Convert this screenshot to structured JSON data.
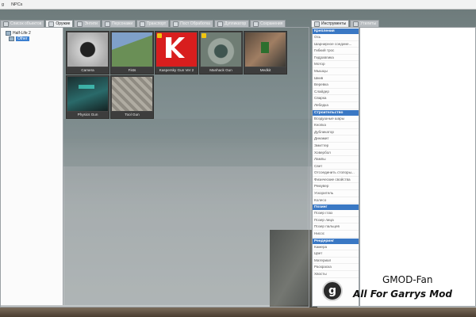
{
  "menu": {
    "items": [
      "g",
      "NPCs"
    ]
  },
  "left_tabs": [
    {
      "label": "Список объектов",
      "active": false
    },
    {
      "label": "Оружие",
      "active": true
    },
    {
      "label": "Энтити",
      "active": false
    },
    {
      "label": "Персонажи",
      "active": false
    },
    {
      "label": "Транспорт",
      "active": false
    },
    {
      "label": "Пост Обработка",
      "active": false
    },
    {
      "label": "Дупликатор",
      "active": false
    },
    {
      "label": "Сохранения",
      "active": false
    }
  ],
  "right_tabs": [
    {
      "label": "Инструменты",
      "active": true
    },
    {
      "label": "Утилиты",
      "active": false
    }
  ],
  "tree": {
    "root": "Half-Life 2",
    "selected": "Other"
  },
  "weapons": [
    {
      "name": "Camera",
      "badge": false,
      "color": "#bfbfbf"
    },
    {
      "name": "Fists",
      "badge": false,
      "color": "#6f8f5a"
    },
    {
      "name": "Kaspersky Gun Ver 2",
      "badge": true,
      "color": "#d81e1e"
    },
    {
      "name": "Manhack Gun",
      "badge": true,
      "color": "#7e8c80"
    },
    {
      "name": "Medkit",
      "badge": false,
      "color": "#8a6a55"
    },
    {
      "name": "Physics Gun",
      "badge": false,
      "color": "#1f5a5a"
    },
    {
      "name": "Tool Gun",
      "badge": false,
      "color": "#9a9a90"
    }
  ],
  "tool_categories": [
    {
      "title": "Крепления",
      "items": [
        "Ось",
        "Шарнирное соедине...",
        "Гибкий трос",
        "Гидравлика",
        "Мотор",
        "Мышцы",
        "Шкив",
        "Веревка",
        "Слайдер",
        "Сварка",
        "Лебедка"
      ]
    },
    {
      "title": "Строительство",
      "items": [
        "Воздушные шары",
        "Кнопка",
        "Дубликатор",
        "Динамит",
        "Эмиттер",
        "Ховербол",
        "Лампы",
        "Свет",
        "Отсоединить стопоры...",
        "Физические свойства",
        "Ремувер",
        "Ускоритель",
        "Колесо"
      ]
    },
    {
      "title": "Позинг",
      "items": [
        "Позер глаз",
        "Позер лица",
        "Позер пальцев",
        "Нисос"
      ]
    },
    {
      "title": "Рендеринг",
      "items": [
        "Камера",
        "Цвет",
        "Материал",
        "Раскраска",
        "Хвосты"
      ]
    }
  ],
  "watermark": {
    "logo": "g",
    "line1": "GMOD-Fan",
    "line2": "All For Garrys Mod"
  }
}
